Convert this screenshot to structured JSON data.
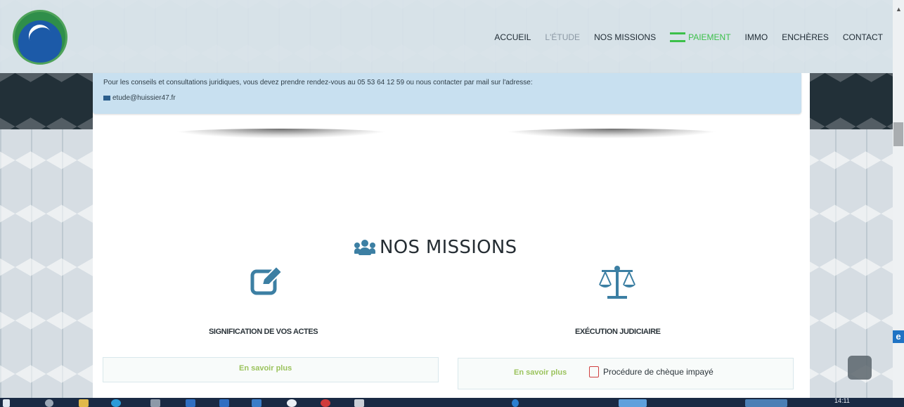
{
  "nav": {
    "items": [
      {
        "label": "ACCUEIL",
        "style": "normal"
      },
      {
        "label": "L'ÉTUDE",
        "style": "muted"
      },
      {
        "label": "NOS MISSIONS",
        "style": "normal"
      },
      {
        "label": "PAIEMENT",
        "style": "pay",
        "icon": "credit-card-icon"
      },
      {
        "label": "IMMO",
        "style": "normal"
      },
      {
        "label": "ENCHÈRES",
        "style": "normal"
      },
      {
        "label": "CONTACT",
        "style": "normal"
      }
    ]
  },
  "notice": {
    "text": "Pour les conseils et consultations juridiques, vous devez prendre rendez-vous au 05 53 64 12 59 ou nous contacter par mail sur l'adresse:",
    "email": "etude@huissier47.fr"
  },
  "section": {
    "title": "NOS MISSIONS",
    "icon": "users-icon"
  },
  "missions": [
    {
      "title": "SIGNIFICATION DE VOS ACTES",
      "icon": "edit-icon",
      "more": "En savoir plus"
    },
    {
      "title": "EXÉCUTION JUDICIAIRE",
      "icon": "scale-icon",
      "more": "En savoir plus",
      "pdf": "Procédure de chèque impayé"
    }
  ],
  "taskbar": {
    "time": "14:11"
  },
  "colors": {
    "accent_green": "#9bc35d",
    "icon_teal": "#3c7fa3",
    "notice_bg": "#c8e0f0"
  }
}
